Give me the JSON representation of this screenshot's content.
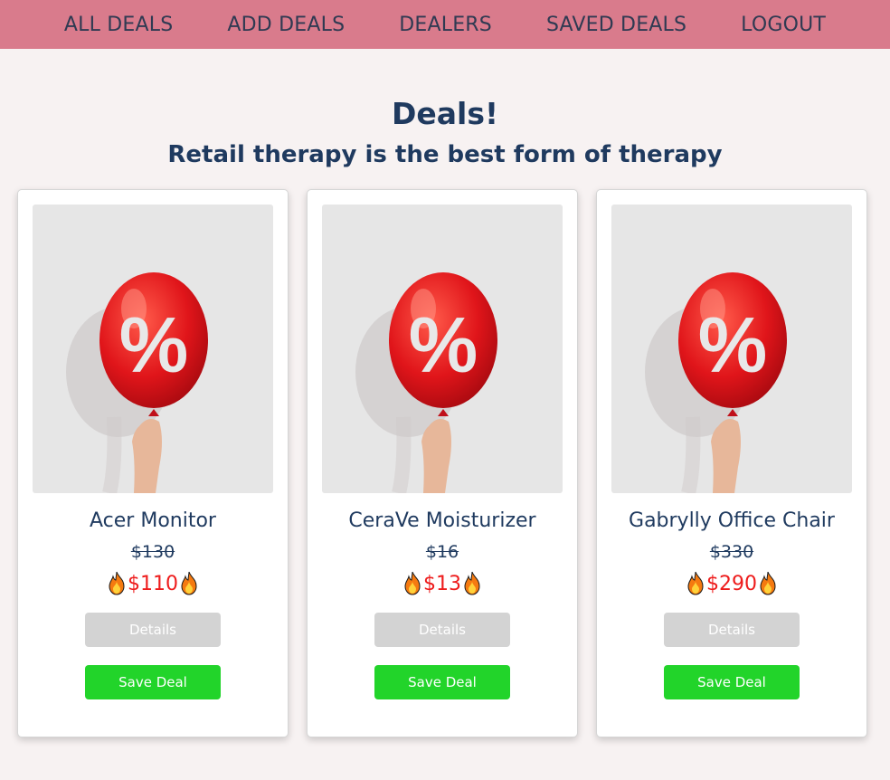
{
  "nav": {
    "items": [
      {
        "label": "ALL DEALS"
      },
      {
        "label": "ADD DEALS"
      },
      {
        "label": "DEALERS"
      },
      {
        "label": "SAVED DEALS"
      },
      {
        "label": "LOGOUT"
      }
    ]
  },
  "header": {
    "title": "Deals!",
    "subtitle": "Retail therapy is the best form of therapy"
  },
  "deals": [
    {
      "title": "Acer Monitor",
      "old_price": "$130",
      "new_price": "$110",
      "details_label": "Details",
      "save_label": "Save Deal"
    },
    {
      "title": "CeraVe Moisturizer",
      "old_price": "$16",
      "new_price": "$13",
      "details_label": "Details",
      "save_label": "Save Deal"
    },
    {
      "title": "Gabrylly Office Chair",
      "old_price": "$330",
      "new_price": "$290",
      "details_label": "Details",
      "save_label": "Save Deal"
    }
  ],
  "colors": {
    "navbar": "#d97b8c",
    "heading": "#1f3a5f",
    "price_red": "#ee1c1c",
    "details_button": "#d3d3d3",
    "save_button": "#22d42a"
  },
  "icons": {
    "deal_image": "percent-balloon-image",
    "price_decoration": "fire-icon"
  }
}
